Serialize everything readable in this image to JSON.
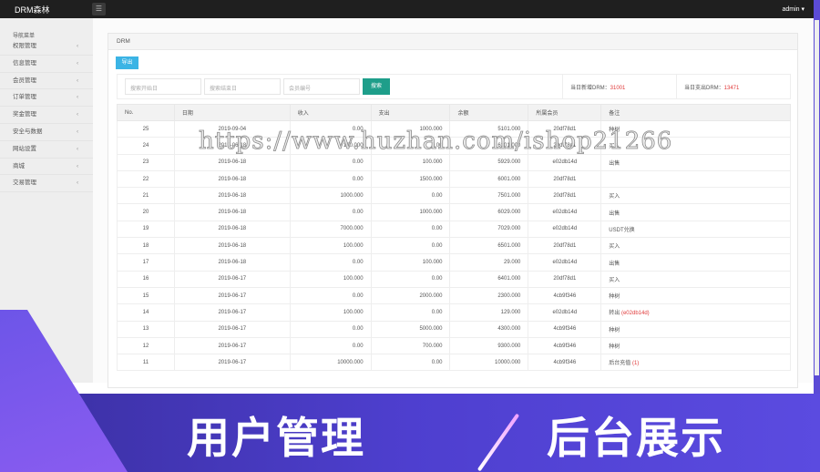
{
  "topbar": {
    "brand": "DRM森林",
    "user": "admin ▾",
    "menu_icon": "☰"
  },
  "sidebar": {
    "heading": "导航菜单",
    "items": [
      "权限管理",
      "信息管理",
      "会员管理",
      "订单管理",
      "奖金管理",
      "安全与数据",
      "网站设置",
      "商城",
      "交易管理"
    ]
  },
  "panel": {
    "title": "DRM",
    "export": "导出"
  },
  "search": {
    "start_placeholder": "搜索开始日",
    "end_placeholder": "搜索结束日",
    "member_placeholder": "会员编号",
    "button": "搜索",
    "new_label": "当日新增DRM：",
    "new_value": "31001",
    "out_label": "当日支出DRM：",
    "out_value": "13471"
  },
  "table": {
    "headers": [
      "No.",
      "日期",
      "收入",
      "支出",
      "余额",
      "所属会员",
      "备注"
    ],
    "rows": [
      [
        "25",
        "2019-09-04",
        "0.00",
        "1000.000",
        "5101.000",
        "20df78d1",
        "种树",
        ""
      ],
      [
        "24",
        "2019-06-18",
        "100.000",
        "0.00",
        "6101.000",
        "20df78d1",
        "买入",
        ""
      ],
      [
        "23",
        "2019-06-18",
        "0.00",
        "100.000",
        "5929.000",
        "e02db14d",
        "出售",
        ""
      ],
      [
        "22",
        "2019-06-18",
        "0.00",
        "1500.000",
        "6001.000",
        "20df78d1",
        "",
        ""
      ],
      [
        "21",
        "2019-06-18",
        "1000.000",
        "0.00",
        "7501.000",
        "20df78d1",
        "买入",
        ""
      ],
      [
        "20",
        "2019-06-18",
        "0.00",
        "1000.000",
        "6029.000",
        "e02db14d",
        "出售",
        ""
      ],
      [
        "19",
        "2019-06-18",
        "7000.000",
        "0.00",
        "7029.000",
        "e02db14d",
        "USDT兑换",
        ""
      ],
      [
        "18",
        "2019-06-18",
        "100.000",
        "0.00",
        "6501.000",
        "20df78d1",
        "买入",
        ""
      ],
      [
        "17",
        "2019-06-18",
        "0.00",
        "100.000",
        "29.000",
        "e02db14d",
        "出售",
        ""
      ],
      [
        "16",
        "2019-06-17",
        "100.000",
        "0.00",
        "6401.000",
        "20df78d1",
        "买入",
        ""
      ],
      [
        "15",
        "2019-06-17",
        "0.00",
        "2000.000",
        "2300.000",
        "4cb9f346",
        "种树",
        ""
      ],
      [
        "14",
        "2019-06-17",
        "100.000",
        "0.00",
        "129.000",
        "e02db14d",
        "转出",
        "(e02db14d)"
      ],
      [
        "13",
        "2019-06-17",
        "0.00",
        "5000.000",
        "4300.000",
        "4cb9f346",
        "种树",
        ""
      ],
      [
        "12",
        "2019-06-17",
        "0.00",
        "700.000",
        "9300.000",
        "4cb9f346",
        "种树",
        ""
      ],
      [
        "11",
        "2019-06-17",
        "10000.000",
        "0.00",
        "10000.000",
        "4cb9f346",
        "后台充值",
        "(1)"
      ]
    ]
  },
  "watermark": "https://www.huzhan.com/ishop21266",
  "banner": {
    "left": "用户管理",
    "right": "后台展示"
  }
}
